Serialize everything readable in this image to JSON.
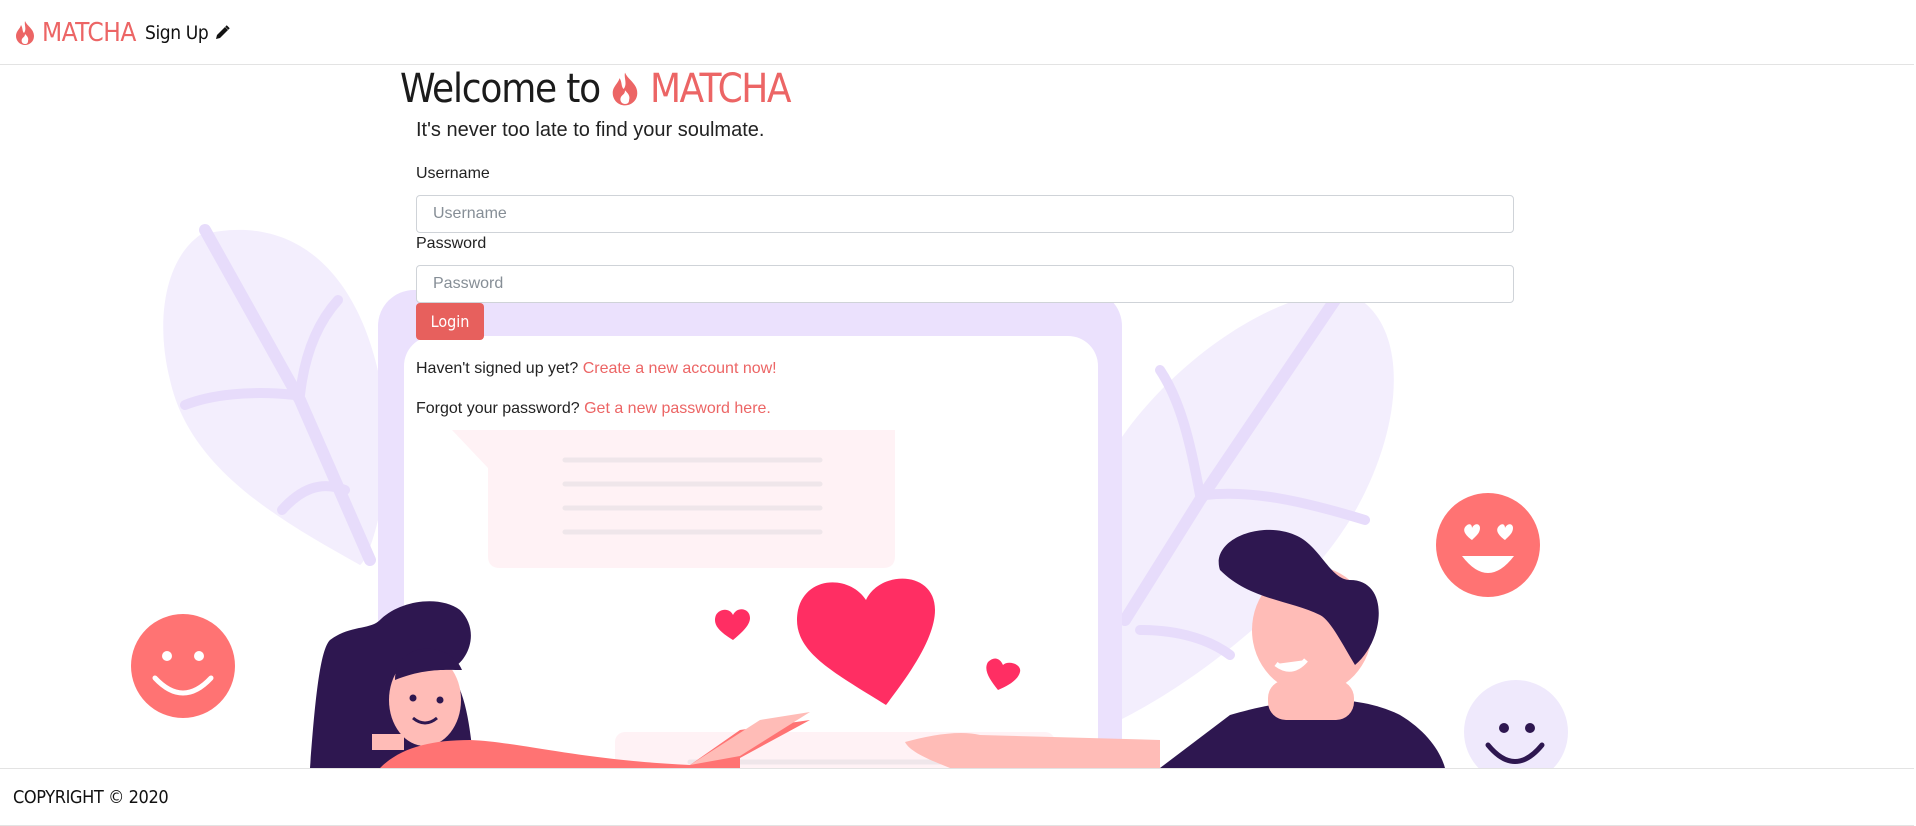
{
  "nav": {
    "brand": "MATCHA",
    "signup_label": "Sign Up",
    "signup_icon": "pencil-icon",
    "brand_icon": "flame-icon"
  },
  "hero": {
    "welcome_text": "Welcome to",
    "brand": "MATCHA",
    "tagline": "It's never too late to find your soulmate."
  },
  "form": {
    "username_label": "Username",
    "username_placeholder": "Username",
    "username_value": "",
    "password_label": "Password",
    "password_placeholder": "Password",
    "password_value": "",
    "login_label": "Login"
  },
  "help": {
    "signup_prompt": "Haven't signed up yet?",
    "signup_link": "Create a new account now!",
    "forgot_prompt": "Forgot your password?",
    "forgot_link": "Get a new password here."
  },
  "footer": {
    "copyright": "COPYRIGHT © 2020"
  },
  "colors": {
    "accent": "#ec6565",
    "button": "#e7605d",
    "heart": "#ff2e63",
    "navy": "#2e1750",
    "lavender": "#ebe1fd"
  }
}
